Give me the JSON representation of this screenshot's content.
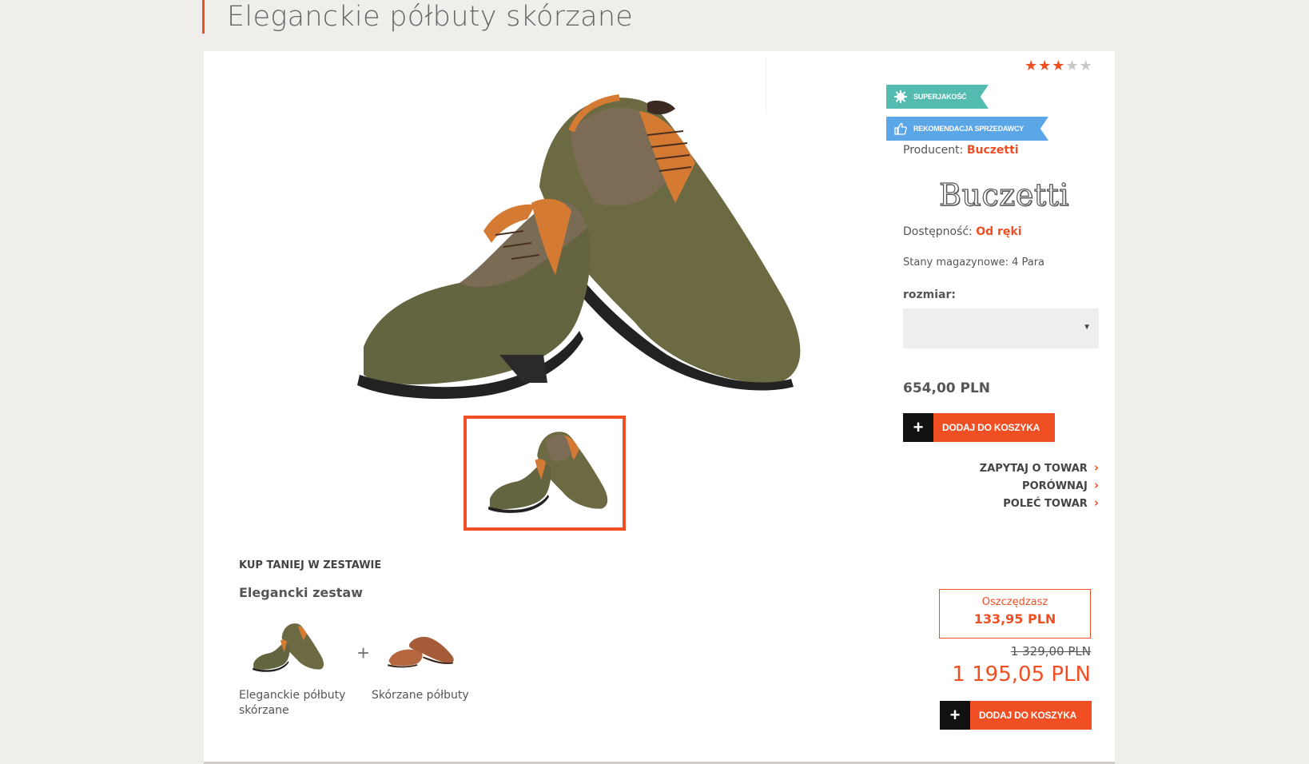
{
  "page": {
    "title": "Eleganckie półbuty skórzane"
  },
  "product": {
    "rating": 3,
    "rating_max": 5,
    "badges": [
      {
        "label": "SUPERJAKOŚĆ",
        "icon": "gear-badge-icon",
        "color": "#53bbb0"
      },
      {
        "label": "REKOMENDACJA SPRZEDAWCY",
        "icon": "thumbs-up-icon",
        "color": "#5aa6e6"
      }
    ],
    "producer_label": "Producent:",
    "producer_value": "Buczetti",
    "brand_logo_text": "Buczetti",
    "availability_label": "Dostępność:",
    "availability_value": "Od ręki",
    "stock_text": "Stany magazynowe: 4 Para",
    "size_label": "rozmiar:",
    "size_value": "",
    "price": "654,00 PLN",
    "add_to_cart": "DODAJ DO KOSZYKA",
    "links": [
      {
        "label": "ZAPYTAJ O TOWAR"
      },
      {
        "label": "PORÓWNAJ"
      },
      {
        "label": "POLEĆ TOWAR"
      }
    ]
  },
  "bundle": {
    "heading": "KUP TANIEJ W ZESTAWIE",
    "name": "Elegancki zestaw",
    "items": [
      {
        "name": "Eleganckie półbuty skórzane"
      },
      {
        "name": "Skórzane półbuty"
      }
    ],
    "plus": "+",
    "save_label": "Oszczędzasz",
    "save_amount": "133,95 PLN",
    "old_price": "1 329,00 PLN",
    "new_price": "1 195,05 PLN",
    "add_to_cart": "DODAJ DO KOSZYKA"
  },
  "colors": {
    "accent": "#f04e23",
    "teal_badge": "#53bbb0",
    "blue_badge": "#5aa6e6",
    "page_bg": "#f0eeeb"
  }
}
